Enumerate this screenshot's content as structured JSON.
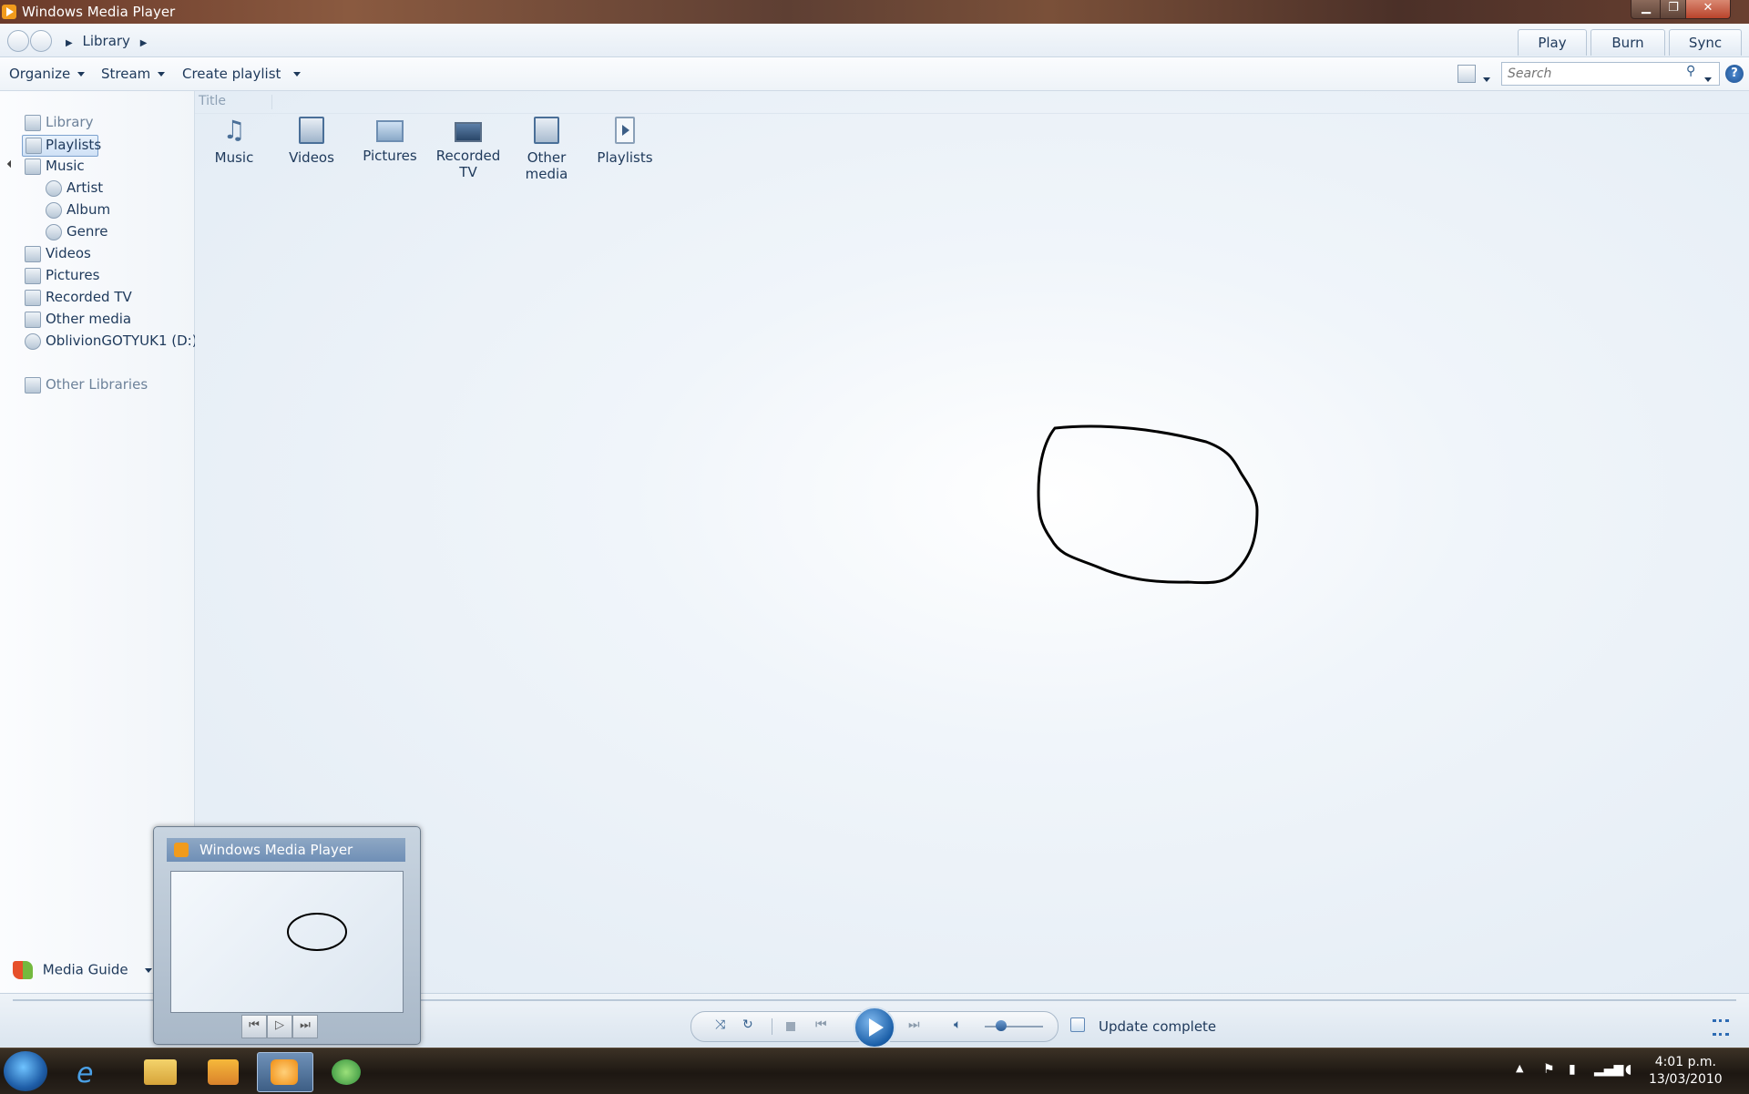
{
  "window": {
    "title": "Windows Media Player"
  },
  "address": {
    "crumbs": [
      "Library"
    ]
  },
  "tabs": {
    "play": "Play",
    "burn": "Burn",
    "sync": "Sync"
  },
  "toolbar": {
    "organize": "Organize",
    "stream": "Stream",
    "create_playlist": "Create playlist",
    "search_placeholder": "Search"
  },
  "nav": {
    "library": "Library",
    "playlists": "Playlists",
    "music": "Music",
    "artist": "Artist",
    "album": "Album",
    "genre": "Genre",
    "videos": "Videos",
    "pictures": "Pictures",
    "recorded_tv": "Recorded TV",
    "other_media": "Other media",
    "drive": "OblivionGOTYUK1 (D:)",
    "other_libraries": "Other Libraries"
  },
  "content": {
    "column_title": "Title",
    "tiles": [
      {
        "line1": "Music",
        "line2": "",
        "icon": "music-note-icon"
      },
      {
        "line1": "Videos",
        "line2": "",
        "icon": "film-icon"
      },
      {
        "line1": "Pictures",
        "line2": "",
        "icon": "picture-icon"
      },
      {
        "line1": "Recorded",
        "line2": "TV",
        "icon": "tv-icon"
      },
      {
        "line1": "Other",
        "line2": "media",
        "icon": "other-media-icon"
      },
      {
        "line1": "Playlists",
        "line2": "",
        "icon": "playlist-icon"
      }
    ]
  },
  "thumbnail": {
    "title": "Windows Media Player"
  },
  "bottom": {
    "media_guide": "Media Guide",
    "status": "Update complete"
  },
  "taskbar": {
    "time": "4:01 p.m.",
    "date": "13/03/2010"
  },
  "colors": {
    "accent": "#1e395b",
    "play": "#1b5fa8"
  }
}
